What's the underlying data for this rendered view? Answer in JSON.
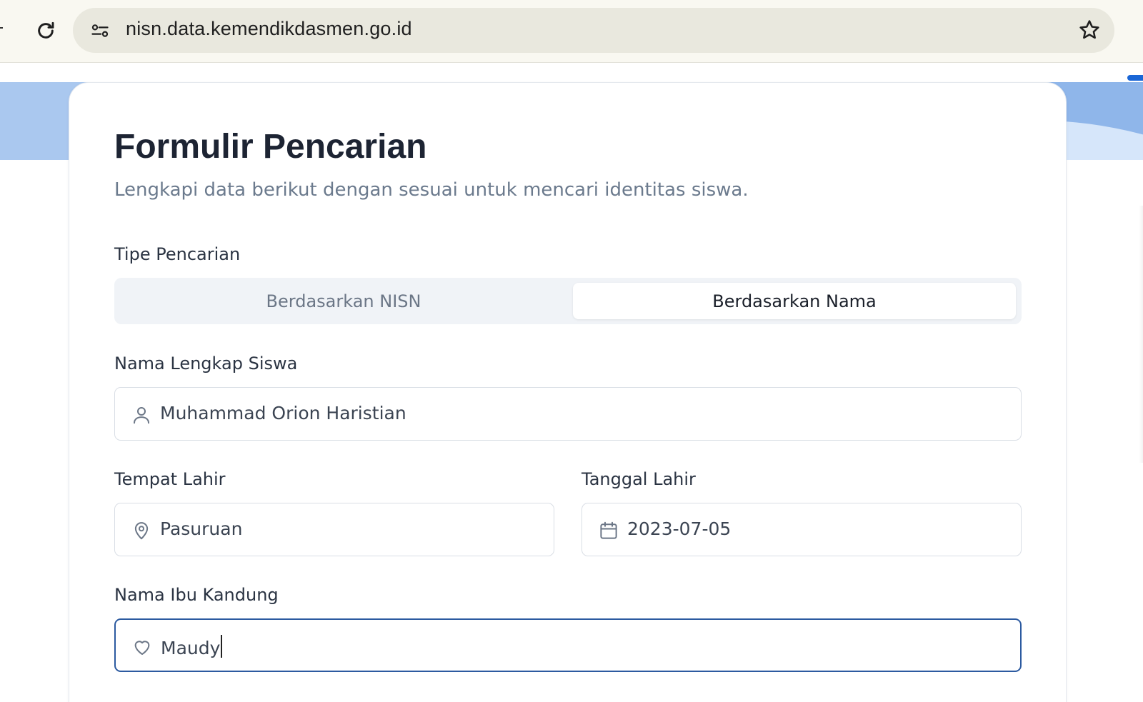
{
  "browser": {
    "url": "nisn.data.kemendikdasmen.go.id"
  },
  "form": {
    "title": "Formulir Pencarian",
    "subtitle": "Lengkapi data berikut dengan sesuai untuk mencari identitas siswa.",
    "search_type": {
      "label": "Tipe Pencarian",
      "options": [
        "Berdasarkan NISN",
        "Berdasarkan Nama"
      ],
      "selected": "Berdasarkan Nama"
    },
    "nama_lengkap": {
      "label": "Nama Lengkap Siswa",
      "value": "Muhammad Orion Haristian",
      "icon": "user-icon"
    },
    "tempat_lahir": {
      "label": "Tempat Lahir",
      "value": "Pasuruan",
      "icon": "map-pin-icon"
    },
    "tanggal_lahir": {
      "label": "Tanggal Lahir",
      "value": "2023-07-05",
      "icon": "calendar-icon"
    },
    "nama_ibu": {
      "label": "Nama Ibu Kandung",
      "value": "Maudy",
      "icon": "heart-icon"
    }
  },
  "colors": {
    "accent": "#2c5aa0",
    "hero": "#aac8ef",
    "title": "#1d2433",
    "muted": "#6b7a8d"
  }
}
